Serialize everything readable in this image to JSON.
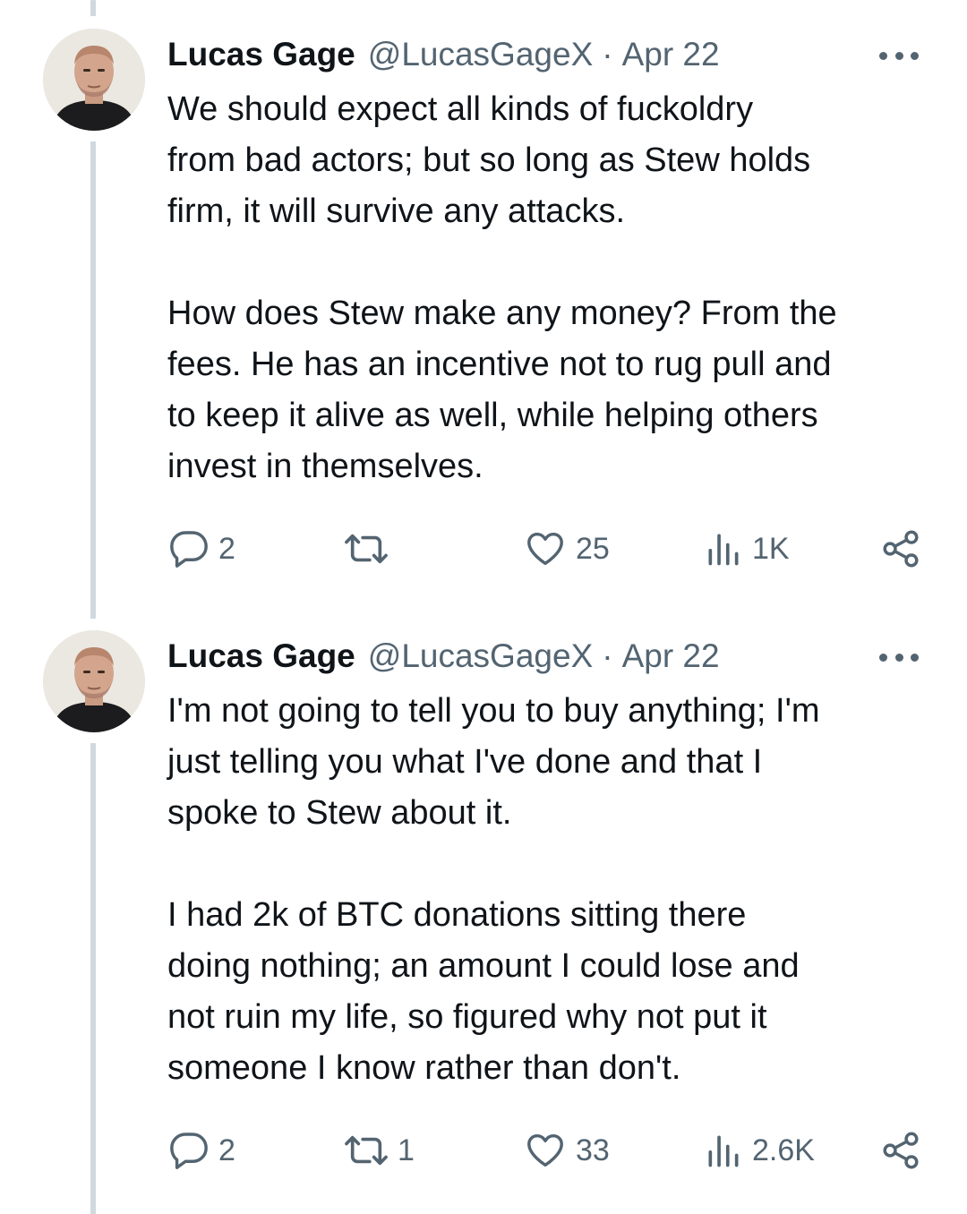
{
  "tweets": [
    {
      "name": "Lucas Gage",
      "handle": "@LucasGageX",
      "separator": "·",
      "date": "Apr 22",
      "paragraphs": [
        "We should expect all kinds of fuckoldry\nfrom bad actors; but so long as Stew holds\nfirm, it will survive any attacks.",
        "How does Stew make any money? From the\nfees. He has an incentive not to rug pull and\nto keep it alive as well, while helping others\ninvest in themselves."
      ],
      "replies": "2",
      "retweets": "",
      "likes": "25",
      "views": "1K"
    },
    {
      "name": "Lucas Gage",
      "handle": "@LucasGageX",
      "separator": "·",
      "date": "Apr 22",
      "paragraphs": [
        "I'm not going to tell you to buy anything; I'm\njust telling you what I've done and that I\nspoke to Stew about it.",
        "I had 2k of BTC donations sitting there\ndoing nothing; an amount I could lose and\nnot ruin my life, so figured why not put it\nsomeone I know rather than don't."
      ],
      "replies": "2",
      "retweets": "1",
      "likes": "33",
      "views": "2.6K"
    }
  ],
  "icons": {
    "reply": "reply-icon",
    "retweet": "retweet-icon",
    "like": "heart-icon",
    "views": "views-icon",
    "share": "share-icon",
    "more": "more-icon"
  },
  "colors": {
    "text": "#0f1419",
    "muted": "#536471",
    "thread_line": "#cfd9de"
  }
}
